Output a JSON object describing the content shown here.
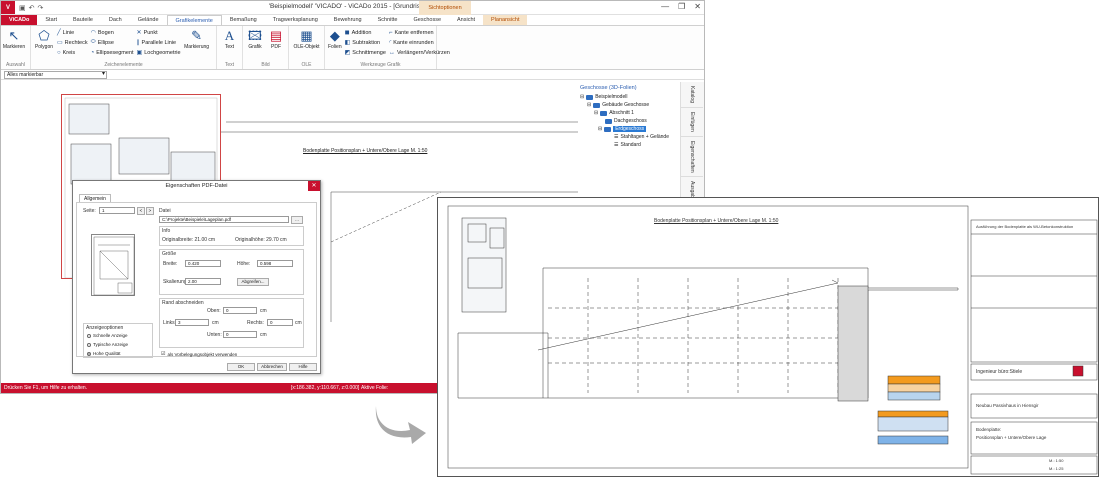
{
  "window": {
    "title": "'Beispielmodell' 'VICADO' - ViCADo 2015 - [Grundriss EG]",
    "context_header": "Sichtoptionen",
    "controls": [
      "—",
      "❐",
      "✕"
    ],
    "qat_icons": [
      "save-icon",
      "undo-icon",
      "redo-icon"
    ]
  },
  "tabs": {
    "file": "ViCADo",
    "items": [
      "Start",
      "Bauteile",
      "Dach",
      "Gelände",
      "Grafikelemente",
      "Bemaßung",
      "Tragwerksplanung",
      "Beweh­rung",
      "Schnitte",
      "Geschosse",
      "Ansicht",
      "Planansicht"
    ],
    "active": "Grafikelemente"
  },
  "ribbon": {
    "auswahl": {
      "label": "Auswahl",
      "btn": "Markieren"
    },
    "zeichen": {
      "label": "Zeichenelemente",
      "polygon": "Polygon",
      "col1": [
        "Linie",
        "Rechteck",
        "Kreis"
      ],
      "col2": [
        "Bogen",
        "Ellipse",
        "Ellipsesegment"
      ],
      "col3": [
        "Punkt",
        "Parallele Linie",
        "Lochgeometrie"
      ],
      "markierung": "Markierung"
    },
    "text": {
      "label": "Text",
      "btn": "Text"
    },
    "bild": {
      "label": "Bild",
      "btn1": "Grafik",
      "btn2": "PDF"
    },
    "ole": {
      "label": "OLE",
      "btn": "OLE-Objekt"
    },
    "werkzeuge": {
      "label": "Werkzeuge Grafik",
      "folien": "Folien",
      "col1": [
        "Addition",
        "Subtraktion",
        "Schnittmenge"
      ],
      "col2": [
        "Kante entfernen",
        "Kante einrunden",
        "Verlängern/Verkürzen"
      ]
    }
  },
  "selector": {
    "value": "Alles markierbar"
  },
  "canvas": {
    "plan_title": "Bodenplatte Positionsplan + Untere/Obere Lage M. 1:50"
  },
  "tree": {
    "header": "Geschosse (3D-Folien)",
    "nodes": [
      {
        "label": "Beispielmodell",
        "level": 0
      },
      {
        "label": "Gebäude Geschosse",
        "level": 1
      },
      {
        "label": "Abschnitt 1",
        "level": 2
      },
      {
        "label": "Dachgeschoss",
        "level": 3
      },
      {
        "label": "Erdgeschoss",
        "level": 3,
        "selected": true
      },
      {
        "label": "Stahltagen + Gelände",
        "level": 4
      },
      {
        "label": "Standard",
        "level": 4
      }
    ]
  },
  "sidetabs": [
    "Katalog",
    "Einfügen",
    "Eigenschaften",
    "Ausgabe"
  ],
  "status": {
    "hint": "Drücken Sie F1, um Hilfe zu erhalten.",
    "coords": "[x:186.382, y:110.667, z:0.000]",
    "layer": "Aktive Folie:"
  },
  "dialog": {
    "title": "Eigenschaften PDF-Datei",
    "tab": "Allgemein",
    "seite_label": "Seite:",
    "seite_value": "1",
    "datei_label": "Datei",
    "datei_value": "C:\\Projekte\\Beispiele\\Lageplan.pdf",
    "browse": "...",
    "info_label": "Info",
    "orig_breite": "Originalbreite: 21.00 cm",
    "orig_hoehe": "Originalhöhe:  29.70 cm",
    "groesse_label": "Größe",
    "breite_label": "Breite:",
    "breite_value": "0.420",
    "hoehe_label": "Höhe:",
    "hoehe_value": "0.598",
    "mst_label": "Skalierung:",
    "mst_value": "2.00",
    "abgreifen": "Abgreifen...",
    "rand_label": "Rand abschneiden",
    "oben_label": "Oben:",
    "oben_value": "0",
    "links_label": "Links:",
    "links_value": "3",
    "rechts_label": "Rechts:",
    "rechts_value": "0",
    "unten_label": "Unten:",
    "unten_value": "0",
    "unit": "cm",
    "anzeige_label": "Anzeigeoptionen",
    "radio1": "Schnelle Anzeige",
    "radio2": "Typische Anzeige",
    "radio3": "Hohe Qualität",
    "checkbox": "als Vorbelegungsobjekt verwenden",
    "ok": "OK",
    "cancel": "Abbrechen",
    "help": "Hilfe"
  },
  "big_plan": {
    "title": "Bodenplatte Positionsplan + Untere/Obere Lage M. 1:50",
    "box_header": "Ausführung der Bodenplatte als WU-Betonkonstruktion",
    "firm": "Ingenieur  büro:Stiele",
    "project": "Neubau Passivhaus in Hiensgir",
    "subject_1": "Bodenplatte:",
    "subject_2": "Positionsplan + Untere/Obere Lage",
    "scale_1": "M.: 1:50",
    "scale_2": "M.: 1:25"
  }
}
